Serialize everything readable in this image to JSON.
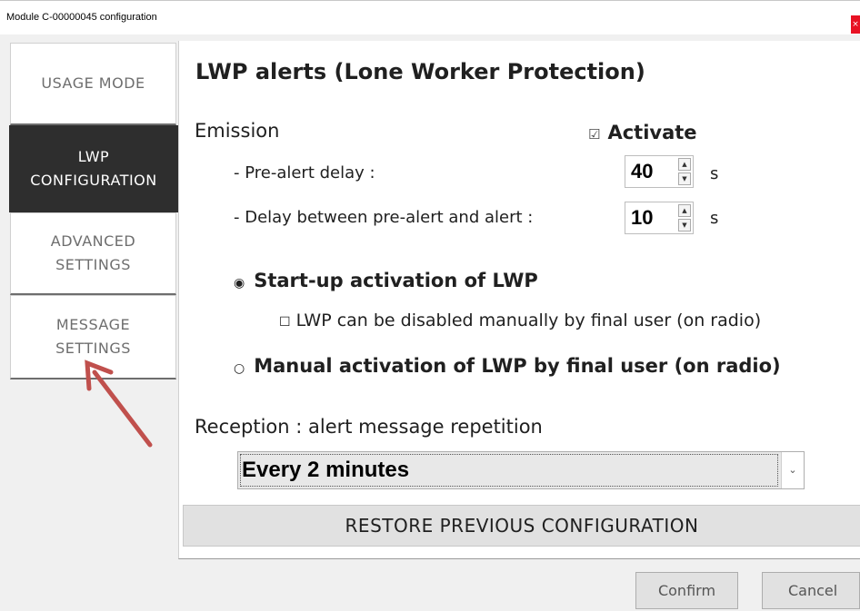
{
  "window": {
    "title": "Module C-00000045 configuration",
    "close_glyph": "×"
  },
  "sidebar": {
    "items": [
      {
        "label": "USAGE MODE",
        "active": false
      },
      {
        "label": "LWP\nCONFIGURATION",
        "active": true
      },
      {
        "label": "ADVANCED\nSETTINGS",
        "active": false
      },
      {
        "label": "MESSAGE\nSETTINGS",
        "active": false
      }
    ]
  },
  "main": {
    "heading": "LWP alerts (Lone Worker Protection)",
    "emission": {
      "label": "Emission",
      "activate_checkbox": "☑",
      "activate_label": "Activate",
      "activate_checked": true,
      "pre_alert_label": "- Pre-alert delay :",
      "pre_alert_value": "40",
      "pre_alert_unit": "s",
      "between_label": "- Delay between pre-alert and alert :",
      "between_value": "10",
      "between_unit": "s"
    },
    "startup_radio": "◉",
    "startup_label": "Start-up activation of LWP",
    "startup_selected": true,
    "disable_checkbox": "☐",
    "disable_label": "LWP can be disabled manually by final user (on radio)",
    "disable_checked": false,
    "manual_radio": "○",
    "manual_label": "Manual activation of LWP by final user (on radio)",
    "manual_selected": false,
    "reception": {
      "label": "Reception : alert message repetition",
      "selected": "Every 2 minutes"
    },
    "restore_label": "RESTORE PREVIOUS CONFIGURATION"
  },
  "footer": {
    "confirm_label": "Confirm",
    "cancel_label": "Cancel"
  },
  "colors": {
    "active_tab": "#2e2e2e",
    "annotation_arrow": "#c0504d",
    "close_button": "#e81123"
  }
}
